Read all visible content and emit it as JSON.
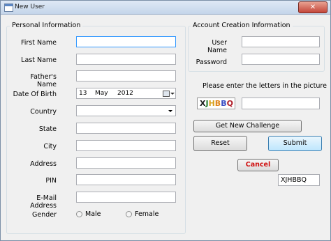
{
  "window": {
    "title": "New User",
    "close_glyph": "✕"
  },
  "personal": {
    "group_title": "Personal Information",
    "first_name_label": "First Name",
    "last_name_label": "Last Name",
    "fathers_name_label": "Father's Name",
    "dob_label": "Date Of Birth",
    "dob_day": "13",
    "dob_month": "May",
    "dob_year": "2012",
    "country_label": "Country",
    "country_value": "",
    "state_label": "State",
    "city_label": "City",
    "address_label": "Address",
    "pin_label": "PIN",
    "email_label": "E-Mail Address",
    "gender_label": "Gender",
    "gender_options": [
      "Male",
      "Female"
    ]
  },
  "account": {
    "group_title": "Account Creation Information",
    "username_label": "User Name",
    "password_label": "Password"
  },
  "captcha": {
    "prompt": "Please enter the letters in the picture",
    "image_chars": [
      "X",
      "J",
      "H",
      "B",
      "B",
      "Q"
    ],
    "image_colors": [
      "#1a1a1a",
      "#1f7a2a",
      "#d8a21e",
      "#e0861a",
      "#3b4fc4",
      "#b01f2a"
    ],
    "get_new_label": "Get New Challenge",
    "display_text": "XJHBBQ"
  },
  "buttons": {
    "reset": "Reset",
    "submit": "Submit",
    "cancel": "Cancel"
  },
  "colors": {
    "cancel_text": "#d01010",
    "focus_border": "#3399ff"
  }
}
